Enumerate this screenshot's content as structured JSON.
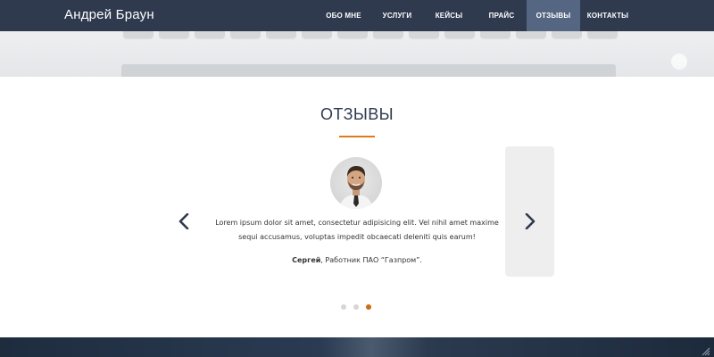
{
  "header": {
    "brand": "Андрей Браун",
    "nav": [
      {
        "label": "ОБО МНЕ",
        "active": false
      },
      {
        "label": "УСЛУГИ",
        "active": false
      },
      {
        "label": "КЕЙСЫ",
        "active": false
      },
      {
        "label": "ПРАЙС",
        "active": false
      },
      {
        "label": "ОТЗЫВЫ",
        "active": true
      },
      {
        "label": "КОНТАКТЫ",
        "active": false
      }
    ]
  },
  "reviews": {
    "title": "ОТЗЫВЫ",
    "text": "Lorem ipsum dolor sit amet, consectetur adipisicing elit. Vel nihil amet maxime sequi accusamus, voluptas impedit obcaecati deleniti quis earum!",
    "author_name": "Сергей",
    "author_role": ", Работник ПАО “Газпром”.",
    "slides_total": 3,
    "active_slide": 3
  },
  "colors": {
    "nav_bg": "#2f3a4e",
    "nav_active_bg": "#556683",
    "accent": "#e07b1c",
    "title": "#2f3a4e"
  },
  "icons": {
    "prev": "chevron-left-icon",
    "next": "chevron-right-icon"
  }
}
